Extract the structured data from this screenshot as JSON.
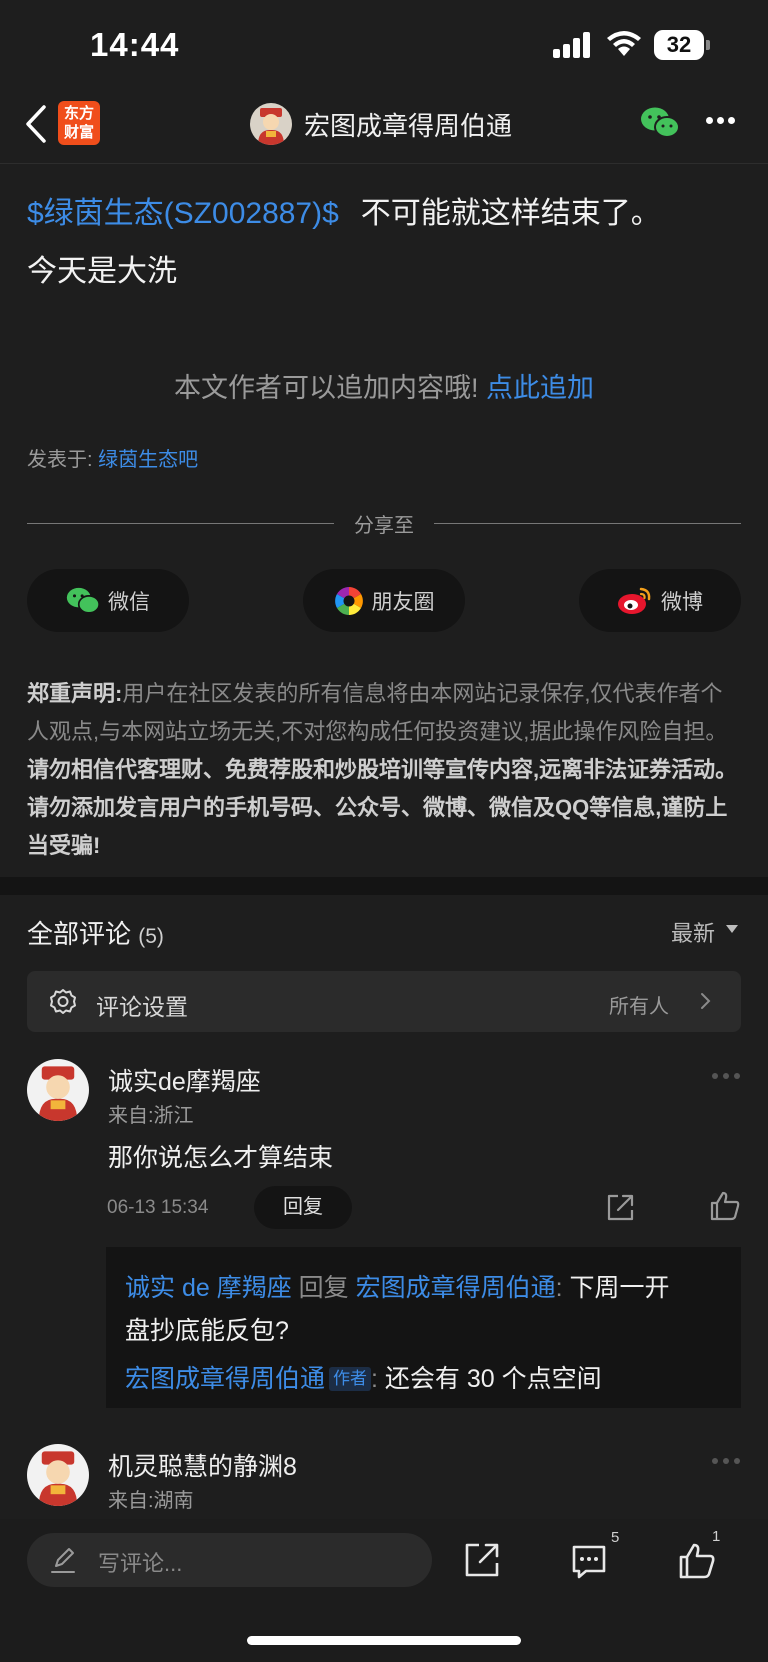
{
  "status_bar": {
    "time": "14:44",
    "battery": "32"
  },
  "nav": {
    "logo_line1": "东方",
    "logo_line2": "财富",
    "title": "宏图成章得周伯通"
  },
  "post": {
    "stock_tag": "$绿茵生态(SZ002887)$",
    "text_line1": "不可能就这样结束了。",
    "text_line2": "今天是大洗",
    "append_prompt": "本文作者可以追加内容哦!",
    "append_link": "点此追加",
    "posted_label": "发表于:",
    "posted_board": "绿茵生态吧"
  },
  "share": {
    "label": "分享至",
    "wechat": "微信",
    "moments": "朋友圈",
    "weibo": "微博"
  },
  "disclaimer": {
    "title": "郑重声明:",
    "normal": "用户在社区发表的所有信息将由本网站记录保存,仅代表作者个人观点,与本网站立场无关,不对您构成任何投资建议,据此操作风险自担。",
    "bold": "请勿相信代客理财、免费荐股和炒股培训等宣传内容,远离非法证券活动。请勿添加发言用户的手机号码、公众号、微博、微信及QQ等信息,谨防上当受骗!"
  },
  "comments": {
    "title": "全部评论",
    "count": "(5)",
    "sort": "最新",
    "settings_label": "评论设置",
    "settings_value": "所有人",
    "items": [
      {
        "name": "诚实de摩羯座",
        "from": "来自:浙江",
        "text": "那你说怎么才算结束",
        "time": "06-13 15:34",
        "reply_label": "回复"
      },
      {
        "name": "机灵聪慧的静渊8",
        "from": "来自:湖南"
      }
    ],
    "replies": {
      "r1_user": "诚实 de 摩羯座",
      "r1_verb": "回复",
      "r1_target": "宏图成章得周伯通",
      "r1_colon": ":",
      "r1_text_a": "下周一开",
      "r1_text_b": "盘抄底能反包?",
      "r2_user": "宏图成章得周伯通",
      "r2_tag": "作者",
      "r2_colon": ":",
      "r2_text": "还会有 30 个点空间"
    }
  },
  "bottom_bar": {
    "placeholder": "写评论...",
    "comment_count": "5",
    "like_count": "1"
  },
  "colors": {
    "background": "#1e1e1e",
    "link_blue": "#3d8ce6",
    "logo_orange": "#f04e1b",
    "wechat_green": "#43c25b"
  }
}
